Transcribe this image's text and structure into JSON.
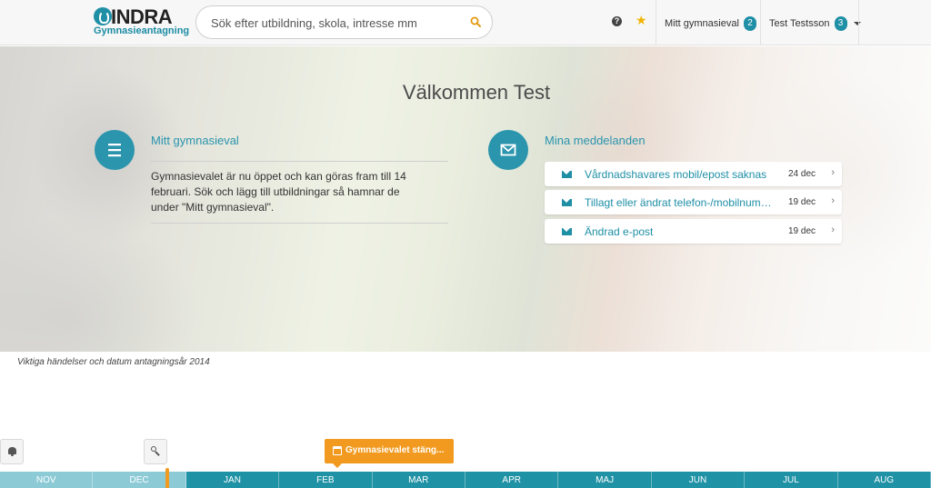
{
  "header": {
    "logo_title": "INDRA",
    "logo_subtitle": "Gymnasieantagning",
    "search_placeholder": "Sök efter utbildning, skola, intresse mm",
    "help_label": "?",
    "my_choice_label": "Mitt gymnasieval",
    "my_choice_count": "2",
    "user_name": "Test Testsson",
    "user_count": "3"
  },
  "hero": {
    "welcome": "Välkommen Test",
    "choice": {
      "title": "Mitt gymnasieval",
      "text": "Gymnasievalet är nu öppet och kan göras fram till 14 februari. Sök och lägg till utbildningar så hamnar de under \"Mitt gymnasieval\"."
    },
    "messages": {
      "title": "Mina meddelanden",
      "items": [
        {
          "subject": "Vårdnadshavares mobil/epost saknas",
          "date": "24 dec"
        },
        {
          "subject": "Tillagt eller ändrat telefon-/mobilnummer",
          "date": "19 dec"
        },
        {
          "subject": "Ändrad e-post",
          "date": "19 dec"
        }
      ]
    }
  },
  "events": {
    "label": "Viktiga händelser och datum antagningsår 2014",
    "marker": "Gymnasievalet stäng..."
  },
  "timeline": {
    "months": [
      "NOV",
      "DEC",
      "JAN",
      "FEB",
      "MAR",
      "APR",
      "MAJ",
      "JUN",
      "JUL",
      "AUG"
    ],
    "past_count": 2
  },
  "colors": {
    "accent": "#1f8fa6",
    "event": "#f29a1f",
    "star": "#f0b400"
  },
  "icons": [
    "search-icon",
    "help-icon",
    "star-icon",
    "menu-icon",
    "envelope-icon",
    "chevron-right-icon",
    "bell-icon",
    "key-icon",
    "calendar-icon",
    "caret-down-icon"
  ]
}
